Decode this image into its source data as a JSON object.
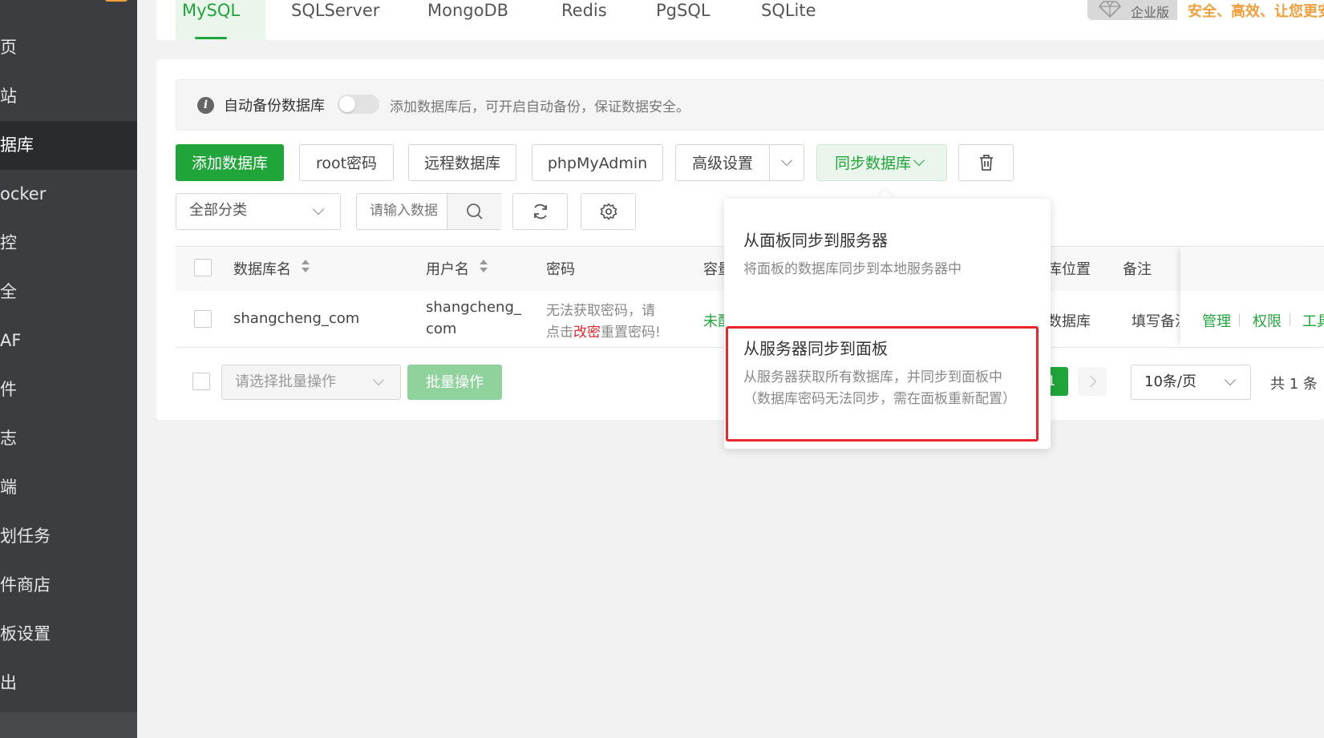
{
  "sidebar": {
    "items": [
      {
        "label": "页"
      },
      {
        "label": "站"
      },
      {
        "label": "据库",
        "active": true
      },
      {
        "label": "ocker"
      },
      {
        "label": "控"
      },
      {
        "label": "全"
      },
      {
        "label": "AF"
      },
      {
        "label": "件"
      },
      {
        "label": "志"
      },
      {
        "label": "端"
      },
      {
        "label": "划任务"
      },
      {
        "label": "件商店"
      },
      {
        "label": "板设置"
      },
      {
        "label": "出"
      }
    ]
  },
  "tabs": [
    {
      "label": "MySQL",
      "active": true
    },
    {
      "label": "SQLServer"
    },
    {
      "label": "MongoDB"
    },
    {
      "label": "Redis"
    },
    {
      "label": "PgSQL"
    },
    {
      "label": "SQLite"
    }
  ],
  "enterprise": {
    "badge": "企业版",
    "slogan": "安全、高效、让您更安"
  },
  "notice": {
    "label": "自动备份数据库",
    "description": "添加数据库后，可开启自动备份，保证数据安全。"
  },
  "toolbar": {
    "add_db": "添加数据库",
    "root_password": "root密码",
    "remote_db": "远程数据库",
    "phpmyadmin": "phpMyAdmin",
    "advanced": "高级设置",
    "sync_db": "同步数据库"
  },
  "filter": {
    "category": "全部分类",
    "search_placeholder": "请输入数据"
  },
  "table": {
    "headers": {
      "name": "数据库名",
      "user": "用户名",
      "password": "密码",
      "capacity": "容量",
      "location": "库位置",
      "note": "备注"
    },
    "rows": [
      {
        "name": "shangcheng_com",
        "user_line1": "shangcheng_",
        "user_line2": "com",
        "password_line1": "无法获取密码，请",
        "password_line2_pre": "点击",
        "password_line2_link": "改密",
        "password_line2_post": "重置密码!",
        "capacity": "未配",
        "location": "数据库",
        "note": "填写备注",
        "actions": [
          "管理",
          "权限",
          "工具"
        ]
      }
    ]
  },
  "footer": {
    "batch_placeholder": "请选择批量操作",
    "batch_button": "批量操作",
    "current_page": "1",
    "page_size": "10条/页",
    "total": "共 1 条"
  },
  "sync_menu": {
    "items": [
      {
        "title": "从面板同步到服务器",
        "desc_line1": "将面板的数据库同步到本地服务器中",
        "desc_line2": ""
      },
      {
        "title": "从服务器同步到面板",
        "desc_line1": "从服务器获取所有数据库，并同步到面板中",
        "desc_line2": "（数据库密码无法同步，需在面板重新配置）"
      }
    ]
  },
  "colors": {
    "accent": "#20a53a",
    "sidebar_bg": "#3b3d41",
    "highlight": "#e8262b",
    "warning": "#f0a03b"
  }
}
